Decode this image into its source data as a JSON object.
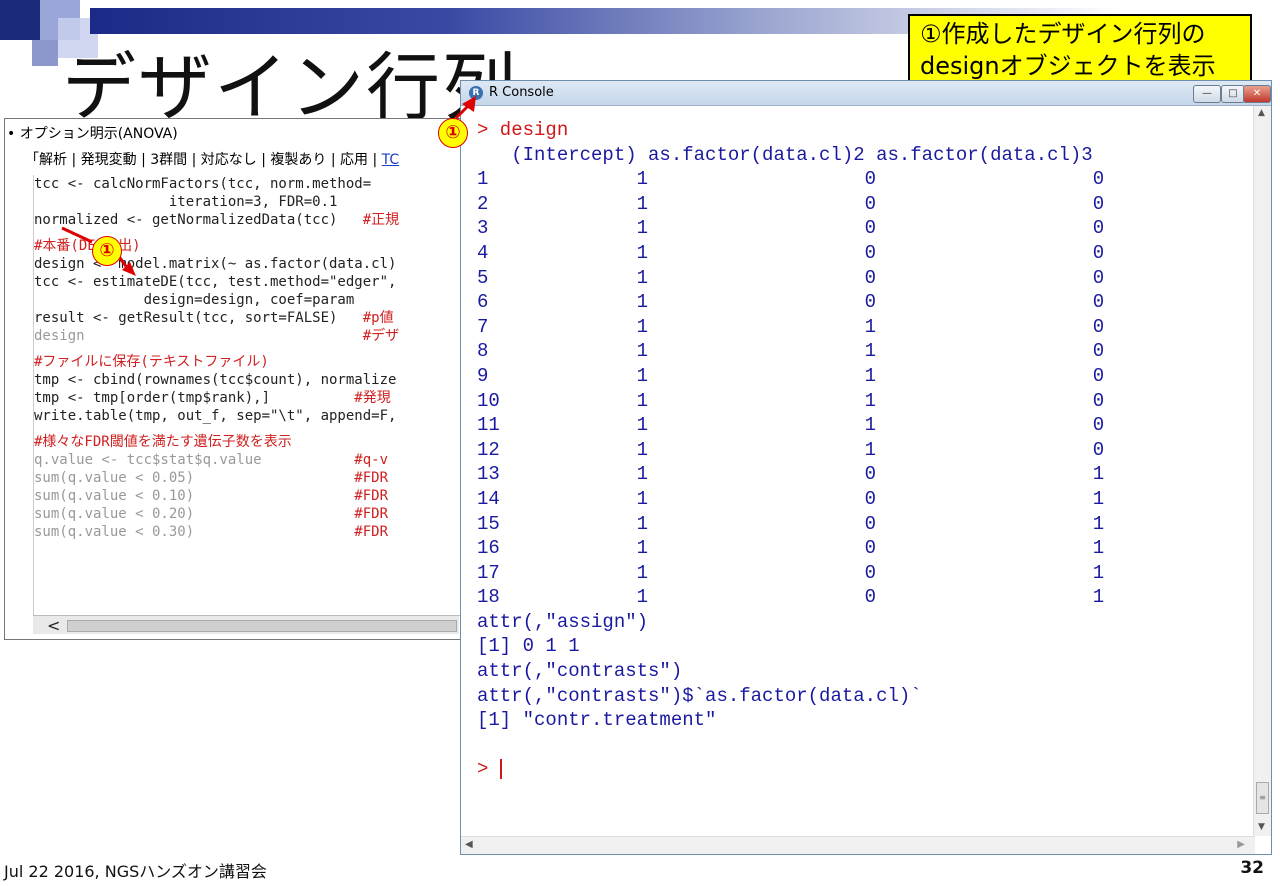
{
  "slide": {
    "title": "デザイン行列",
    "callout": [
      "①作成したデザイン行列の",
      "designオブジェクトを表示"
    ],
    "footer": "Jul 22 2016, NGSハンズオン講習会",
    "page_number": "32",
    "marker": "①"
  },
  "script_panel": {
    "bullet": "• オプション明示(ANOVA)",
    "tabs": [
      "「解析",
      "発現変動",
      "3群間",
      "対応なし",
      "複製あり",
      "応用",
      "TC"
    ],
    "selected_tab": "TC",
    "code_lines": [
      {
        "text": "tcc <- calcNormFactors(tcc, norm.method=",
        "cls": ""
      },
      {
        "text": "                iteration=3, FDR=0.1",
        "cls": ""
      },
      {
        "text": "normalized <- getNormalizedData(tcc)   #正規",
        "cls": "mixed1"
      },
      {
        "text": "",
        "cls": "gap"
      },
      {
        "text": "#本番(DEG検出)",
        "cls": "red"
      },
      {
        "text": "design <- model.matrix(~ as.factor(data.cl)",
        "cls": ""
      },
      {
        "text": "tcc <- estimateDE(tcc, test.method=\"edger\",",
        "cls": ""
      },
      {
        "text": "             design=design, coef=param",
        "cls": ""
      },
      {
        "text": "result <- getResult(tcc, sort=FALSE)   #p値",
        "cls": "mixed2"
      },
      {
        "text": "design                                 #デザ",
        "cls": "mixed3"
      },
      {
        "text": "",
        "cls": "gap"
      },
      {
        "text": "#ファイルに保存(テキストファイル)",
        "cls": "red"
      },
      {
        "text": "tmp <- cbind(rownames(tcc$count), normalize",
        "cls": ""
      },
      {
        "text": "tmp <- tmp[order(tmp$rank),]          #発現",
        "cls": "mixed4"
      },
      {
        "text": "write.table(tmp, out_f, sep=\"\\t\", append=F,",
        "cls": ""
      },
      {
        "text": "",
        "cls": "gap"
      },
      {
        "text": "#様々なFDR閾値を満たす遺伝子数を表示",
        "cls": "red"
      },
      {
        "text": "q.value <- tcc$stat$q.value           #q-v",
        "cls": "mixed5"
      },
      {
        "text": "sum(q.value < 0.05)                   #FDR",
        "cls": "mixed5"
      },
      {
        "text": "sum(q.value < 0.10)                   #FDR",
        "cls": "mixed5"
      },
      {
        "text": "sum(q.value < 0.20)                   #FDR",
        "cls": "mixed5"
      },
      {
        "text": "sum(q.value < 0.30)                   #FDR",
        "cls": "mixed5"
      }
    ],
    "scroll_left": "<"
  },
  "r_console": {
    "title": "R Console",
    "command": "> design",
    "header": "   (Intercept) as.factor(data.cl)2 as.factor(data.cl)3",
    "rows": [
      [
        "1",
        "1",
        "0",
        "0"
      ],
      [
        "2",
        "1",
        "0",
        "0"
      ],
      [
        "3",
        "1",
        "0",
        "0"
      ],
      [
        "4",
        "1",
        "0",
        "0"
      ],
      [
        "5",
        "1",
        "0",
        "0"
      ],
      [
        "6",
        "1",
        "0",
        "0"
      ],
      [
        "7",
        "1",
        "1",
        "0"
      ],
      [
        "8",
        "1",
        "1",
        "0"
      ],
      [
        "9",
        "1",
        "1",
        "0"
      ],
      [
        "10",
        "1",
        "1",
        "0"
      ],
      [
        "11",
        "1",
        "1",
        "0"
      ],
      [
        "12",
        "1",
        "1",
        "0"
      ],
      [
        "13",
        "1",
        "0",
        "1"
      ],
      [
        "14",
        "1",
        "0",
        "1"
      ],
      [
        "15",
        "1",
        "0",
        "1"
      ],
      [
        "16",
        "1",
        "0",
        "1"
      ],
      [
        "17",
        "1",
        "0",
        "1"
      ],
      [
        "18",
        "1",
        "0",
        "1"
      ]
    ],
    "trailer": [
      "attr(,\"assign\")",
      "[1] 0 1 1",
      "attr(,\"contrasts\")",
      "attr(,\"contrasts\")$`as.factor(data.cl)`",
      "[1] \"contr.treatment\""
    ],
    "prompt": "> "
  }
}
